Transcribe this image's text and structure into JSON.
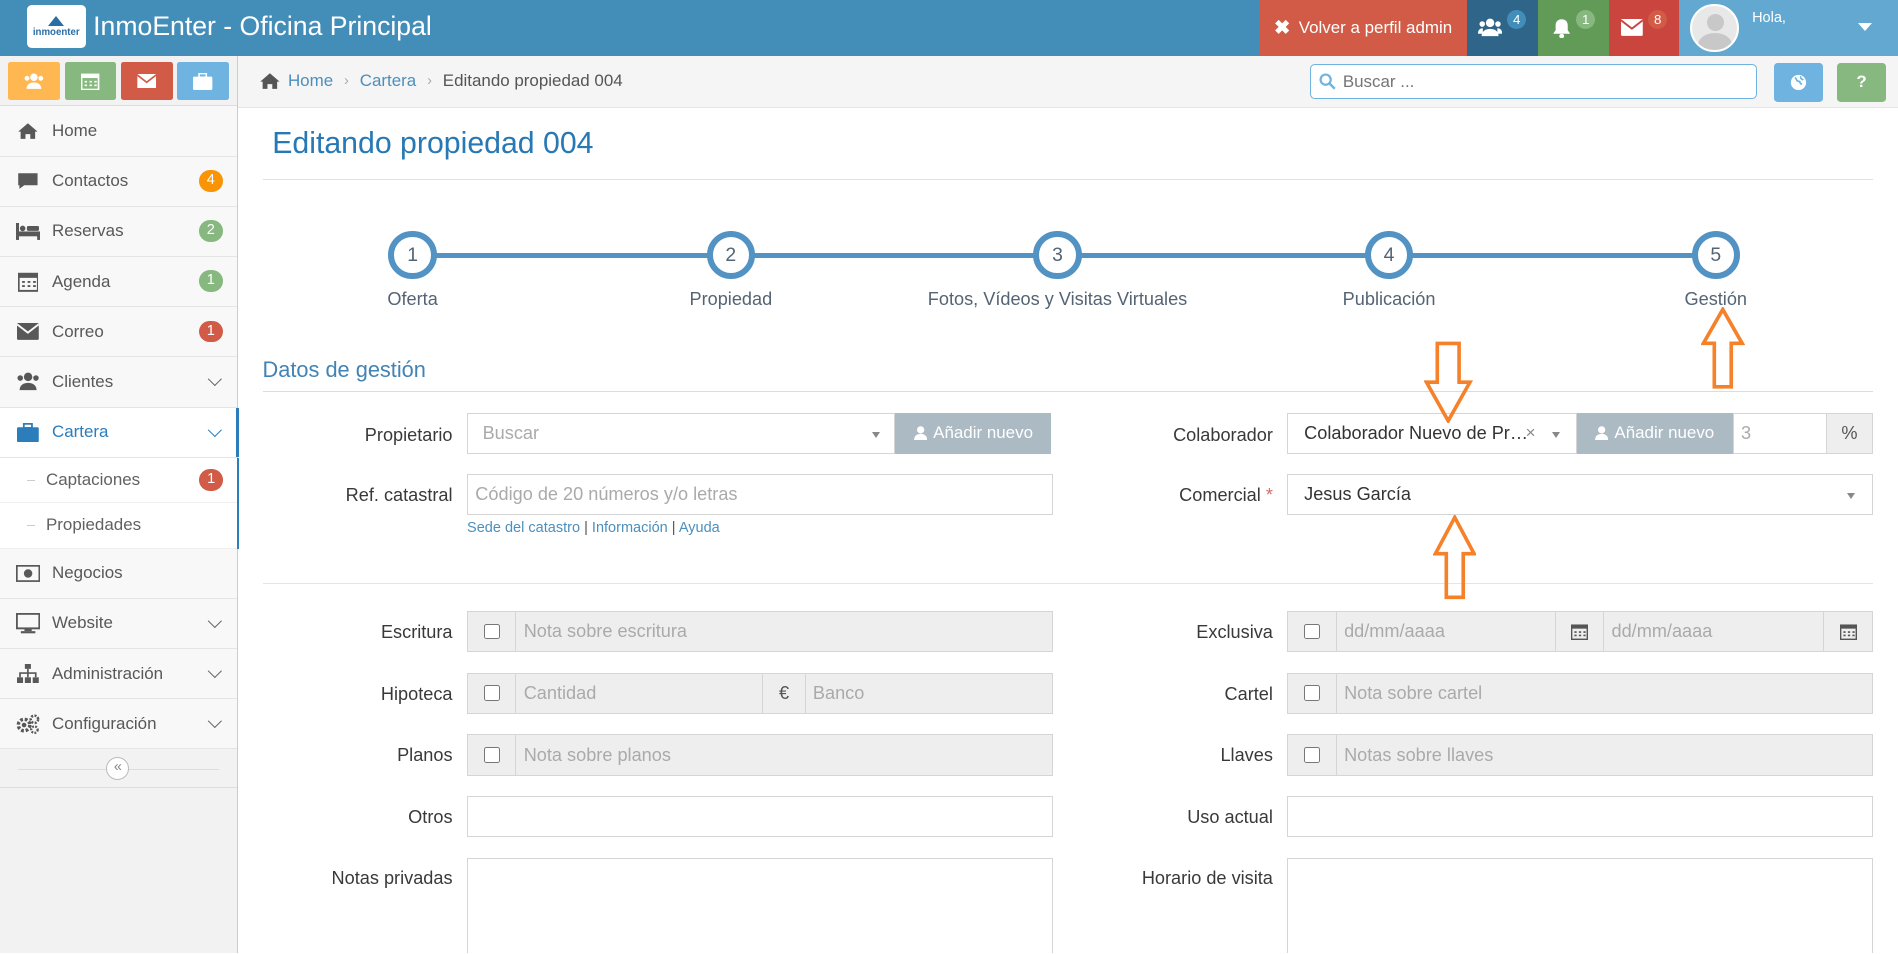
{
  "navbar": {
    "brand": "InmoEnter - Oficina Principal",
    "logo_text": "inmoenter",
    "admin_label": "Volver a perfil admin",
    "groups_count": "4",
    "alerts_count": "1",
    "mail_count": "8",
    "greeting": "Hola,"
  },
  "sidebar": {
    "shortcuts": [
      "users-icon",
      "calendar-icon",
      "envelope-icon",
      "briefcase-icon"
    ],
    "items": [
      {
        "label": "Home"
      },
      {
        "label": "Contactos",
        "count": "4"
      },
      {
        "label": "Reservas",
        "count": "2"
      },
      {
        "label": "Agenda",
        "count": "1"
      },
      {
        "label": "Correo",
        "count": "1"
      },
      {
        "label": "Clientes"
      },
      {
        "label": "Cartera"
      },
      {
        "label": "Negocios"
      },
      {
        "label": "Website"
      },
      {
        "label": "Administración"
      },
      {
        "label": "Configuración"
      }
    ],
    "subitems": [
      {
        "label": "Captaciones",
        "count": "1"
      },
      {
        "label": "Propiedades"
      }
    ]
  },
  "breadcrumb": {
    "home": "Home",
    "cartera": "Cartera",
    "current": "Editando propiedad 004"
  },
  "search": {
    "placeholder": "Buscar ..."
  },
  "page": {
    "title": "Editando propiedad 004"
  },
  "wizard": {
    "steps": [
      {
        "num": "1",
        "label": "Oferta"
      },
      {
        "num": "2",
        "label": "Propiedad"
      },
      {
        "num": "3",
        "label": "Fotos, Vídeos y Visitas Virtuales"
      },
      {
        "num": "4",
        "label": "Publicación"
      },
      {
        "num": "5",
        "label": "Gestión"
      }
    ]
  },
  "section_title": "Datos de gestión",
  "form": {
    "propietario": {
      "label": "Propietario",
      "placeholder": "Buscar",
      "add": "Añadir nuevo"
    },
    "ref_catastral": {
      "label": "Ref. catastral",
      "placeholder": "Código de 20 números y/o letras"
    },
    "links": {
      "sede": "Sede del catastro",
      "info": "Información",
      "ayuda": "Ayuda",
      "sep": "|"
    },
    "colaborador": {
      "label": "Colaborador",
      "value": "Colaborador Nuevo de Pr…",
      "clear": "×",
      "add": "Añadir nuevo",
      "percent_placeholder": "3",
      "percent": "%"
    },
    "comercial": {
      "label": "Comercial",
      "required": "*",
      "value": "Jesus García"
    },
    "escritura": {
      "label": "Escritura",
      "placeholder": "Nota sobre escritura"
    },
    "hipoteca": {
      "label": "Hipoteca",
      "cantidad": "Cantidad",
      "currency": "€",
      "banco": "Banco"
    },
    "planos": {
      "label": "Planos",
      "placeholder": "Nota sobre planos"
    },
    "otros": {
      "label": "Otros"
    },
    "notas": {
      "label": "Notas privadas"
    },
    "exclusiva": {
      "label": "Exclusiva",
      "date1": "dd/mm/aaaa",
      "date2": "dd/mm/aaaa"
    },
    "cartel": {
      "label": "Cartel",
      "placeholder": "Nota sobre cartel"
    },
    "llaves": {
      "label": "Llaves",
      "placeholder": "Notas sobre llaves"
    },
    "uso": {
      "label": "Uso actual"
    },
    "horario": {
      "label": "Horario de visita"
    }
  },
  "colors": {
    "navbar": "#438eb9",
    "accent": "#2679b5",
    "annotation": "#f5822a"
  }
}
